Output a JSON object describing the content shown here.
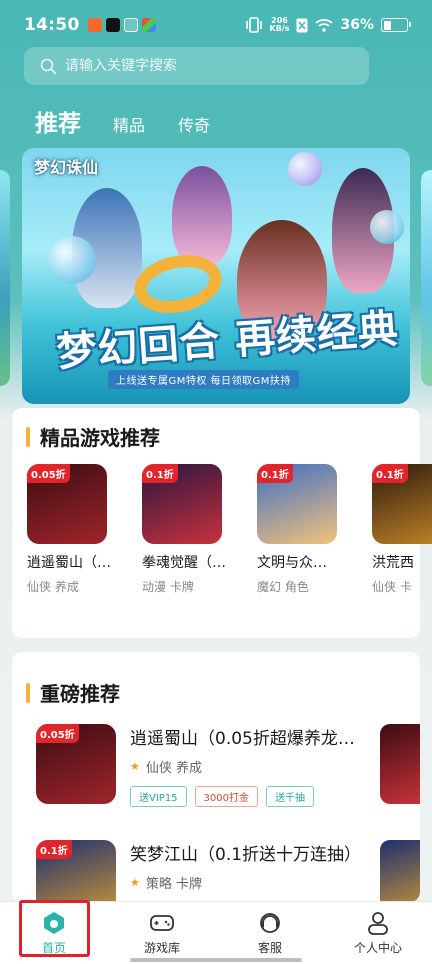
{
  "status_bar": {
    "time": "14:50",
    "net_speed_value": "206",
    "net_speed_unit": "KB/s",
    "battery": "36%",
    "battery_level": 0.36
  },
  "search": {
    "placeholder": "请输入关键字搜索",
    "icon": "search-icon"
  },
  "tabs": [
    {
      "label": "推荐",
      "active": true
    },
    {
      "label": "精品",
      "active": false
    },
    {
      "label": "传奇",
      "active": false
    }
  ],
  "banner": {
    "logo": "梦幻诛仙",
    "headline": "梦幻回合 再续经典",
    "subline": "上线送专属GM特权  每日领取GM扶持"
  },
  "premium_section": {
    "title": "精品游戏推荐",
    "games": [
      {
        "name": "逍遥蜀山（…",
        "tags": "仙侠 养成",
        "badge": "0.05折",
        "colors": [
          "#3b0d10",
          "#a0252c"
        ]
      },
      {
        "name": "拳魂觉醒（…",
        "tags": "动漫 卡牌",
        "badge": "0.1折",
        "colors": [
          "#2a1640",
          "#c9313d"
        ]
      },
      {
        "name": "文明与众…",
        "tags": "魔幻 角色",
        "badge": "0.1折",
        "colors": [
          "#3e6fc6",
          "#f3c27a"
        ]
      },
      {
        "name": "洪荒西行",
        "tags": "仙侠 卡",
        "badge": "0.1折",
        "colors": [
          "#2b1a0e",
          "#c6862a"
        ]
      }
    ]
  },
  "featured_section": {
    "title": "重磅推荐",
    "items": [
      {
        "title": "逍遥蜀山（0.05折超爆养龙…",
        "category": "仙侠 养成",
        "chips": [
          {
            "text": "送VIP15",
            "style": "teal"
          },
          {
            "text": "3000打金",
            "style": "red"
          },
          {
            "text": "送千抽",
            "style": "teal"
          }
        ],
        "badge": "0.05折",
        "colors": [
          "#3b0d10",
          "#a0252c"
        ]
      },
      {
        "title": "笑梦江山（0.1折送十万连抽）",
        "category": "策略 卡牌",
        "chips": [],
        "badge": "0.1折",
        "colors": [
          "#1d2f6e",
          "#d39b36"
        ]
      }
    ]
  },
  "bottom_nav": [
    {
      "label": "首页",
      "icon": "home-icon",
      "active": true
    },
    {
      "label": "游戏库",
      "icon": "gamepad-icon",
      "active": false
    },
    {
      "label": "客服",
      "icon": "headset-icon",
      "active": false
    },
    {
      "label": "个人中心",
      "icon": "user-icon",
      "active": false
    }
  ],
  "accent_color": "#2ab3ad",
  "highlight_color": "#e0202a"
}
